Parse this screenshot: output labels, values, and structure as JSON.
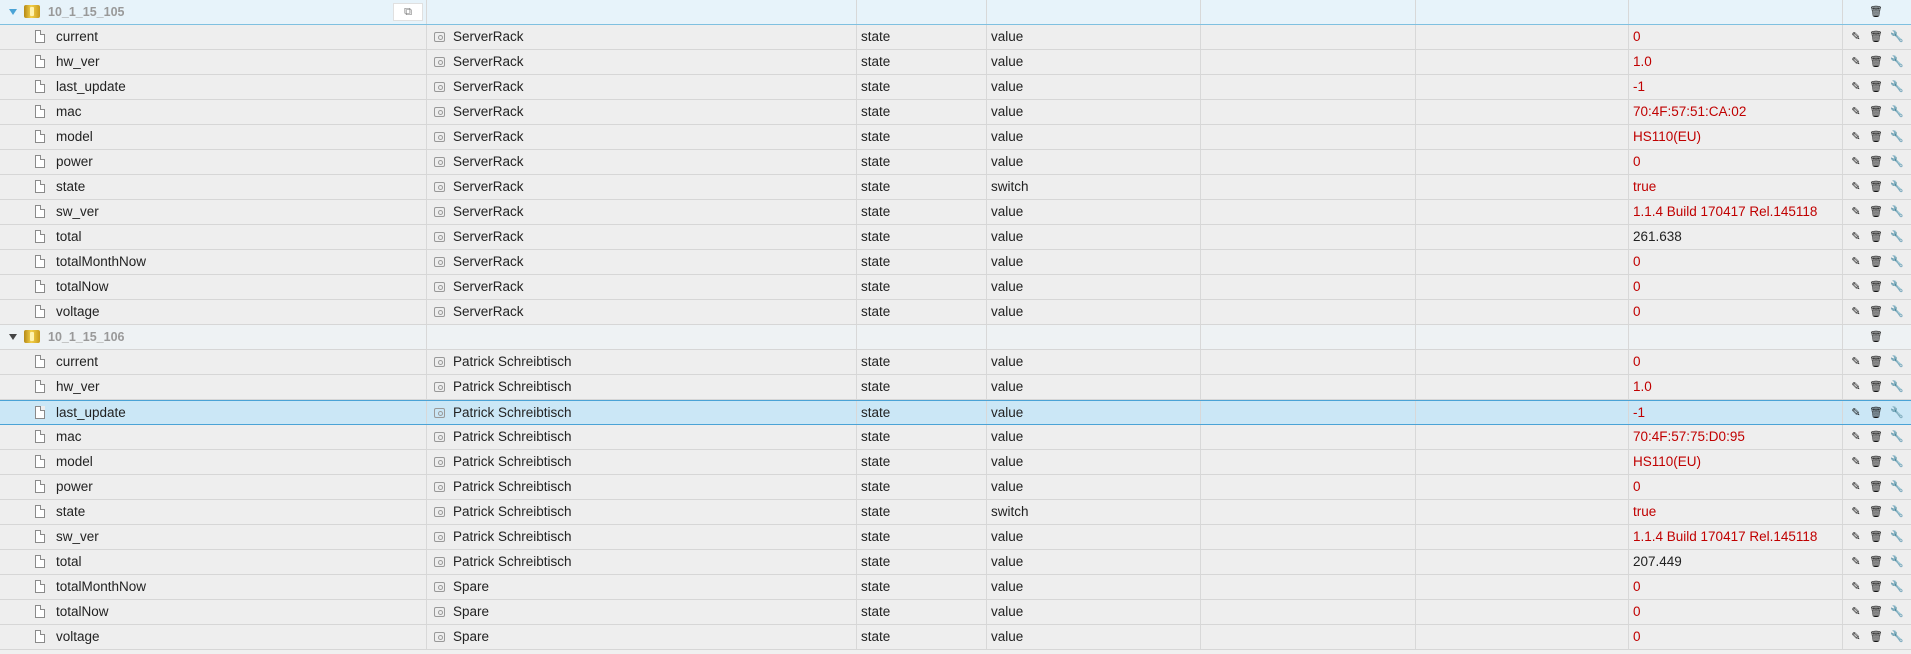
{
  "icons": {
    "edit": "✎",
    "delete": "🗑",
    "wrench": "🔧",
    "copy": "⧉"
  },
  "groups": [
    {
      "folder": "10_1_15_105",
      "rows": [
        {
          "name": "current",
          "room": "ServerRack",
          "role": "state",
          "func": "value",
          "val": "0",
          "red": true
        },
        {
          "name": "hw_ver",
          "room": "ServerRack",
          "role": "state",
          "func": "value",
          "val": "1.0",
          "red": true
        },
        {
          "name": "last_update",
          "room": "ServerRack",
          "role": "state",
          "func": "value",
          "val": "-1",
          "red": true
        },
        {
          "name": "mac",
          "room": "ServerRack",
          "role": "state",
          "func": "value",
          "val": "70:4F:57:51:CA:02",
          "red": true
        },
        {
          "name": "model",
          "room": "ServerRack",
          "role": "state",
          "func": "value",
          "val": "HS110(EU)",
          "red": true
        },
        {
          "name": "power",
          "room": "ServerRack",
          "role": "state",
          "func": "value",
          "val": "0",
          "red": true
        },
        {
          "name": "state",
          "room": "ServerRack",
          "role": "state",
          "func": "switch",
          "val": "true",
          "red": true
        },
        {
          "name": "sw_ver",
          "room": "ServerRack",
          "role": "state",
          "func": "value",
          "val": "1.1.4 Build 170417 Rel.145118",
          "red": true
        },
        {
          "name": "total",
          "room": "ServerRack",
          "role": "state",
          "func": "value",
          "val": "261.638",
          "red": false
        },
        {
          "name": "totalMonthNow",
          "room": "ServerRack",
          "role": "state",
          "func": "value",
          "val": "0",
          "red": true
        },
        {
          "name": "totalNow",
          "room": "ServerRack",
          "role": "state",
          "func": "value",
          "val": "0",
          "red": true
        },
        {
          "name": "voltage",
          "room": "ServerRack",
          "role": "state",
          "func": "value",
          "val": "0",
          "red": true
        }
      ]
    },
    {
      "folder": "10_1_15_106",
      "rows": [
        {
          "name": "current",
          "room": "Patrick Schreibtisch",
          "role": "state",
          "func": "value",
          "val": "0",
          "red": true
        },
        {
          "name": "hw_ver",
          "room": "Patrick Schreibtisch",
          "role": "state",
          "func": "value",
          "val": "1.0",
          "red": true
        },
        {
          "name": "last_update",
          "room": "Patrick Schreibtisch",
          "role": "state",
          "func": "value",
          "val": "-1",
          "red": true,
          "selected": true
        },
        {
          "name": "mac",
          "room": "Patrick Schreibtisch",
          "role": "state",
          "func": "value",
          "val": "70:4F:57:75:D0:95",
          "red": true
        },
        {
          "name": "model",
          "room": "Patrick Schreibtisch",
          "role": "state",
          "func": "value",
          "val": "HS110(EU)",
          "red": true
        },
        {
          "name": "power",
          "room": "Patrick Schreibtisch",
          "role": "state",
          "func": "value",
          "val": "0",
          "red": true
        },
        {
          "name": "state",
          "room": "Patrick Schreibtisch",
          "role": "state",
          "func": "switch",
          "val": "true",
          "red": true
        },
        {
          "name": "sw_ver",
          "room": "Patrick Schreibtisch",
          "role": "state",
          "func": "value",
          "val": "1.1.4 Build 170417 Rel.145118",
          "red": true
        },
        {
          "name": "total",
          "room": "Patrick Schreibtisch",
          "role": "state",
          "func": "value",
          "val": "207.449",
          "red": false
        },
        {
          "name": "totalMonthNow",
          "room": "Spare",
          "role": "state",
          "func": "value",
          "val": "0",
          "red": true
        },
        {
          "name": "totalNow",
          "room": "Spare",
          "role": "state",
          "func": "value",
          "val": "0",
          "red": true
        },
        {
          "name": "voltage",
          "room": "Spare",
          "role": "state",
          "func": "value",
          "val": "0",
          "red": true
        }
      ]
    }
  ]
}
